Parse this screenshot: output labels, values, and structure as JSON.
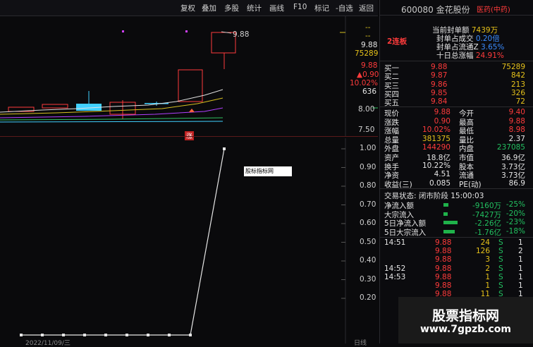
{
  "toolbar": {
    "items": [
      "复权",
      "叠加",
      "多股",
      "统计",
      "画线",
      "F10",
      "标记",
      "-自选",
      "返回"
    ]
  },
  "stock": {
    "code_name": "600080 金花股份",
    "sector": "医药(中药)"
  },
  "limit_info": {
    "consecutive": "2连板",
    "seal_amount_label": "当前封单额",
    "seal_amount": "7439万",
    "seal_ratio_label": "封单占成交",
    "seal_ratio": "0.20倍",
    "seal_float_label": "封单占流通Z",
    "seal_float": "3.65%",
    "ten_day_label": "十日总涨幅",
    "ten_day": "24.91%"
  },
  "kline_labels": {
    "high_annotation": "9.88",
    "right_prices": [
      "9.88",
      "75289",
      "9.88",
      "▲0.90",
      "10.02%",
      "636"
    ],
    "y_ticks": [
      "8.00",
      "7.50"
    ],
    "zhang_badge": "涨"
  },
  "indicator": {
    "label": "股标指标网",
    "y_ticks": [
      "1.00",
      "0.90",
      "0.80",
      "0.70",
      "0.60",
      "0.50",
      "0.40",
      "0.30",
      "0.20"
    ],
    "date_label": "2022/11/09/三",
    "corner_label": "日线"
  },
  "order_book": [
    {
      "label": "买一",
      "price": "9.88",
      "vol": "75289"
    },
    {
      "label": "买二",
      "price": "9.87",
      "vol": "842"
    },
    {
      "label": "买三",
      "price": "9.86",
      "vol": "213"
    },
    {
      "label": "买四",
      "price": "9.85",
      "vol": "326"
    },
    {
      "label": "买五",
      "price": "9.84",
      "vol": "72"
    }
  ],
  "quote": [
    {
      "l1": "现价",
      "v1": "9.88",
      "l2": "今开",
      "v2": "9.40"
    },
    {
      "l1": "涨跌",
      "v1": "0.90",
      "l2": "最高",
      "v2": "9.88"
    },
    {
      "l1": "涨幅",
      "v1": "10.02%",
      "l2": "最低",
      "v2": "8.98"
    },
    {
      "l1": "总量",
      "v1": "381375",
      "l2": "量比",
      "v2": "2.37"
    },
    {
      "l1": "外盘",
      "v1": "144290",
      "l2": "内盘",
      "v2": "237085"
    },
    {
      "l1": "资产",
      "v1": "18.8亿",
      "l2": "市值",
      "v2": "36.9亿"
    },
    {
      "l1": "换手",
      "v1": "10.22%",
      "l2": "股本",
      "v2": "3.73亿"
    },
    {
      "l1": "净资",
      "v1": "4.51",
      "l2": "流通",
      "v2": "3.73亿"
    },
    {
      "l1": "收益(三)",
      "v1": "0.085",
      "l2": "PE(动)",
      "v2": "86.9"
    }
  ],
  "trade_status": "交易状态: 闭市阶段 15:00:03",
  "flows": [
    {
      "label": "净流入额",
      "value": "-9160万",
      "pct": "-25%",
      "bar": 0.15
    },
    {
      "label": "大宗流入",
      "value": "-7427万",
      "pct": "-20%",
      "bar": 0.13
    },
    {
      "label": "5日净流入额",
      "value": "-2.26亿",
      "pct": "-23%",
      "bar": 0.45
    },
    {
      "label": "5日大宗流入",
      "value": "-1.76亿",
      "pct": "-18%",
      "bar": 0.36
    }
  ],
  "ticks": [
    {
      "time": "14:51",
      "price": "9.88",
      "vol": "24",
      "side": "S",
      "num": "1"
    },
    {
      "time": "",
      "price": "9.88",
      "vol": "126",
      "side": "S",
      "num": "2"
    },
    {
      "time": "",
      "price": "9.88",
      "vol": "3",
      "side": "S",
      "num": "1"
    },
    {
      "time": "14:52",
      "price": "9.88",
      "vol": "2",
      "side": "S",
      "num": "1"
    },
    {
      "time": "14:53",
      "price": "9.88",
      "vol": "1",
      "side": "S",
      "num": "1"
    },
    {
      "time": "",
      "price": "9.88",
      "vol": "1",
      "side": "S",
      "num": "1"
    },
    {
      "time": "",
      "price": "9.88",
      "vol": "11",
      "side": "S",
      "num": "1"
    }
  ],
  "watermark": {
    "line1": "股票指标网",
    "line2": "www.7gpzb.com"
  },
  "colors": {
    "up": "#ff3b3b",
    "down": "#22c060",
    "price_yellow": "#e6c21a",
    "limit_candle": "#ff3b3b",
    "ma_white": "#e0e0e0",
    "ma_yellow": "#d8c020",
    "ma_purple": "#b040ff",
    "ma_green": "#30c060",
    "ma_cyan": "#40d0ff"
  },
  "chart_data": {
    "type": "line",
    "title": "",
    "xlabel": "",
    "ylabel": "",
    "ylim": [
      0.2,
      1.0
    ],
    "series": [
      {
        "values": [
          0,
          0,
          0,
          0,
          0,
          0,
          0,
          0,
          0,
          1.0
        ]
      }
    ]
  }
}
